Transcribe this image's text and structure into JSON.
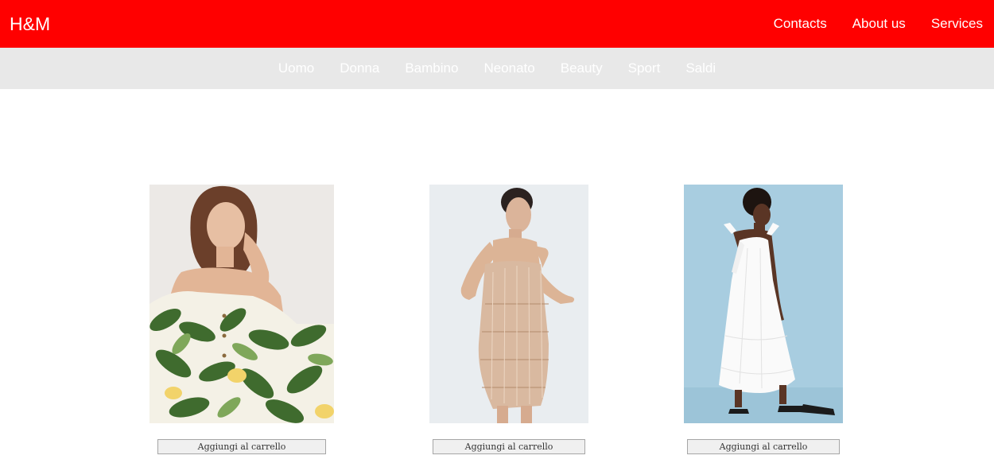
{
  "header": {
    "logo": "H&M",
    "links": [
      "Contacts",
      "About us",
      "Services"
    ],
    "background_color": "#ff0000"
  },
  "categories": [
    "Uomo",
    "Donna",
    "Bambino",
    "Neonato",
    "Beauty",
    "Sport",
    "Saldi"
  ],
  "products": [
    {
      "image": "model in green leaf and lemon print dress",
      "button": "Aggiungi al carrello"
    },
    {
      "image": "model in beige sequin fringe mini dress",
      "button": "Aggiungi al carrello"
    },
    {
      "image": "model in white tiered maxi dress",
      "button": "Aggiungi al carrello"
    }
  ]
}
